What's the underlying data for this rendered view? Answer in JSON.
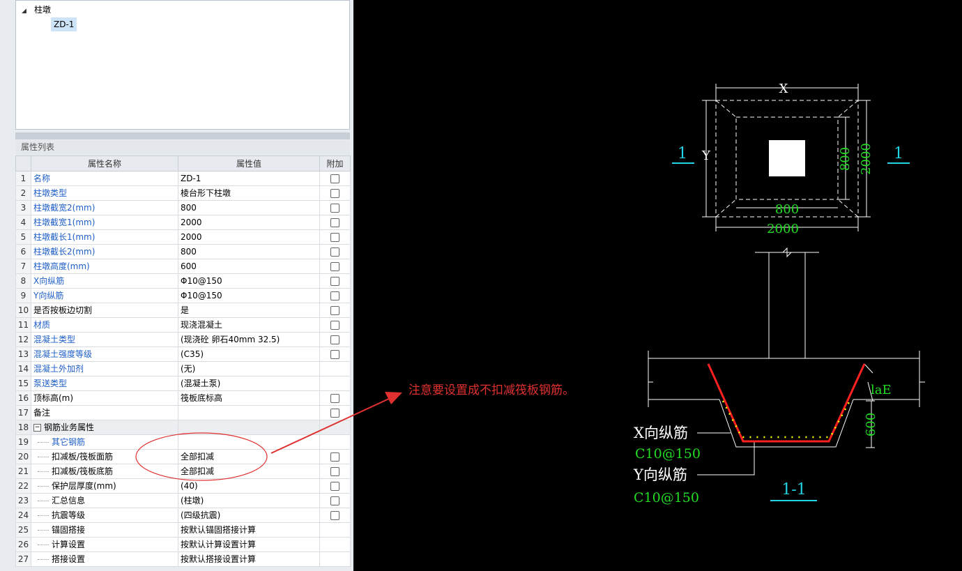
{
  "tree": {
    "root_label": "柱墩",
    "child_label": "ZD-1"
  },
  "properties": {
    "title": "属性列表",
    "columns": [
      "属性名称",
      "属性值",
      "附加"
    ],
    "rows": [
      {
        "n": "1",
        "name": "名称",
        "value": "ZD-1",
        "color": "blue",
        "check": true,
        "indent": 0
      },
      {
        "n": "2",
        "name": "柱墩类型",
        "value": "棱台形下柱墩",
        "color": "blue",
        "check": true,
        "indent": 0
      },
      {
        "n": "3",
        "name": "柱墩截宽2(mm)",
        "value": "800",
        "color": "blue",
        "check": true,
        "indent": 0
      },
      {
        "n": "4",
        "name": "柱墩截宽1(mm)",
        "value": "2000",
        "color": "blue",
        "check": true,
        "indent": 0
      },
      {
        "n": "5",
        "name": "柱墩截长1(mm)",
        "value": "2000",
        "color": "blue",
        "check": true,
        "indent": 0
      },
      {
        "n": "6",
        "name": "柱墩截长2(mm)",
        "value": "800",
        "color": "blue",
        "check": true,
        "indent": 0
      },
      {
        "n": "7",
        "name": "柱墩高度(mm)",
        "value": "600",
        "color": "blue",
        "check": true,
        "indent": 0
      },
      {
        "n": "8",
        "name": "X向纵筋",
        "value": "Φ10@150",
        "color": "blue",
        "check": true,
        "indent": 0
      },
      {
        "n": "9",
        "name": "Y向纵筋",
        "value": "Φ10@150",
        "color": "blue",
        "check": true,
        "indent": 0
      },
      {
        "n": "10",
        "name": "是否按板边切割",
        "value": "是",
        "color": "black",
        "check": true,
        "indent": 0
      },
      {
        "n": "11",
        "name": "材质",
        "value": "现浇混凝土",
        "color": "blue",
        "check": true,
        "indent": 0
      },
      {
        "n": "12",
        "name": "混凝土类型",
        "value": "(现浇砼 卵石40mm 32.5)",
        "color": "blue",
        "check": true,
        "indent": 0
      },
      {
        "n": "13",
        "name": "混凝土强度等级",
        "value": "(C35)",
        "color": "blue",
        "check": true,
        "indent": 0
      },
      {
        "n": "14",
        "name": "混凝土外加剂",
        "value": "(无)",
        "color": "blue",
        "check": false,
        "indent": 0
      },
      {
        "n": "15",
        "name": "泵送类型",
        "value": "(混凝土泵)",
        "color": "blue",
        "check": false,
        "indent": 0
      },
      {
        "n": "16",
        "name": "顶标高(m)",
        "value": "筏板底标高",
        "color": "black",
        "check": true,
        "indent": 0
      },
      {
        "n": "17",
        "name": "备注",
        "value": "",
        "color": "black",
        "check": true,
        "indent": 0
      },
      {
        "n": "18",
        "name": "钢筋业务属性",
        "value": "",
        "color": "black",
        "check": false,
        "indent": 0,
        "group": true
      },
      {
        "n": "19",
        "name": "其它钢筋",
        "value": "",
        "color": "blue",
        "check": false,
        "indent": 1
      },
      {
        "n": "20",
        "name": "扣减板/筏板面筋",
        "value": "全部扣减",
        "color": "black",
        "check": true,
        "indent": 1
      },
      {
        "n": "21",
        "name": "扣减板/筏板底筋",
        "value": "全部扣减",
        "color": "black",
        "check": true,
        "indent": 1
      },
      {
        "n": "22",
        "name": "保护层厚度(mm)",
        "value": "(40)",
        "color": "black",
        "check": true,
        "indent": 1
      },
      {
        "n": "23",
        "name": "汇总信息",
        "value": "(柱墩)",
        "color": "black",
        "check": true,
        "indent": 1
      },
      {
        "n": "24",
        "name": "抗震等级",
        "value": "(四级抗震)",
        "color": "black",
        "check": true,
        "indent": 1
      },
      {
        "n": "25",
        "name": "锚固搭接",
        "value": "按默认锚固搭接计算",
        "color": "black",
        "check": false,
        "indent": 1
      },
      {
        "n": "26",
        "name": "计算设置",
        "value": "按默认计算设置计算",
        "color": "black",
        "check": false,
        "indent": 1
      },
      {
        "n": "27",
        "name": "搭接设置",
        "value": "按默认搭接设置计算",
        "color": "black",
        "check": false,
        "indent": 1
      }
    ]
  },
  "annotation": {
    "note": "注意要设置成不扣减筏板钢筋。",
    "color": "#e03030"
  },
  "drawing": {
    "plan_x_label": "X",
    "plan_y_label": "Y",
    "dim_800_top": "800",
    "dim_2000_bottom": "2000",
    "dim_800_right": "800",
    "dim_2000_right": "2000",
    "section_left": "1",
    "section_right": "1",
    "lae_label": "laE",
    "height_label": "600",
    "x_bar_label": "X向纵筋",
    "x_bar_spec": "C10@150",
    "y_bar_label": "Y向纵筋",
    "y_bar_spec": "C10@150",
    "section_title": "1-1",
    "colors": {
      "white": "#ffffff",
      "green": "#22dd22",
      "cyan": "#22d3e6",
      "red": "#ff2020",
      "yellow": "#ffff00"
    }
  }
}
